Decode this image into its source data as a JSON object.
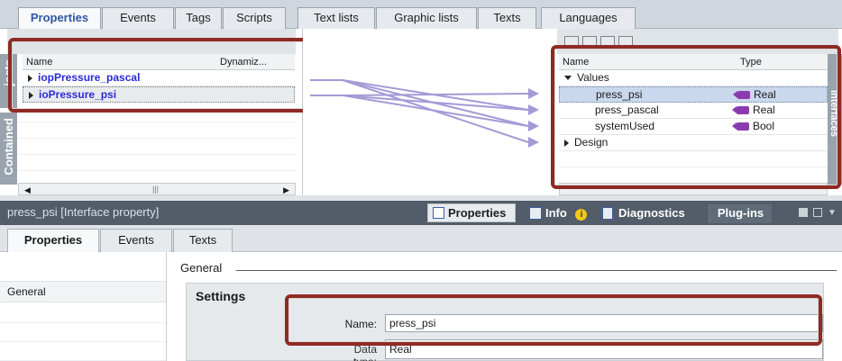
{
  "top_tabs": [
    "Properties",
    "Events",
    "Tags",
    "Scripts",
    "Text lists",
    "Graphic lists",
    "Texts",
    "Languages"
  ],
  "left": {
    "col_name": "Name",
    "col_dyn": "Dynamiz...",
    "rows": [
      "iopPressure_pascal",
      "ioPressure_psi"
    ],
    "side_labels": {
      "objects": "jects",
      "contained": "Contained"
    }
  },
  "right": {
    "col_name": "Name",
    "col_type": "Type",
    "group_values": "Values",
    "items": [
      {
        "name": "press_psi",
        "type": "Real"
      },
      {
        "name": "press_pascal",
        "type": "Real"
      },
      {
        "name": "systemUsed",
        "type": "Bool"
      }
    ],
    "group_design": "Design",
    "side_label": "Interfaces"
  },
  "title_bar": {
    "title": "press_psi [Interface property]",
    "buttons": {
      "properties": "Properties",
      "info": "Info",
      "diagnostics": "Diagnostics",
      "plugins": "Plug-ins"
    }
  },
  "lower_tabs": [
    "Properties",
    "Events",
    "Texts"
  ],
  "side_nav": {
    "general": "General"
  },
  "content": {
    "section": "General",
    "settings": "Settings",
    "name_label": "Name:",
    "name_value": "press_psi",
    "datatype_label": "Data type:",
    "datatype_value": "Real"
  },
  "colors": {
    "frame": "#8f2a24",
    "titlebar": "#525d69",
    "link": "#2a2ad9",
    "badge": "#8b3bb0",
    "arrow": "#a39ad6"
  }
}
